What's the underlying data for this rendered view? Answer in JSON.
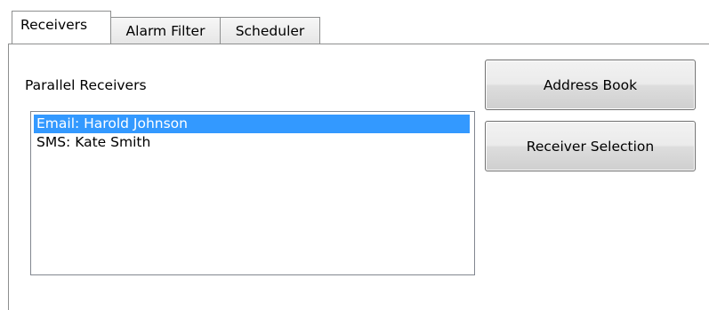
{
  "tabs": [
    {
      "label": "Receivers",
      "active": true
    },
    {
      "label": "Alarm Filter",
      "active": false
    },
    {
      "label": "Scheduler",
      "active": false
    }
  ],
  "receivers_panel": {
    "group_label": "Parallel Receivers",
    "list_items": [
      {
        "label": "Email: Harold Johnson",
        "selected": true
      },
      {
        "label": "SMS: Kate Smith",
        "selected": false
      }
    ]
  },
  "buttons": {
    "address_book": "Address Book",
    "receiver_selection": "Receiver Selection"
  },
  "colors": {
    "selection_highlight": "#3399ff",
    "selection_text": "#ffffff"
  }
}
